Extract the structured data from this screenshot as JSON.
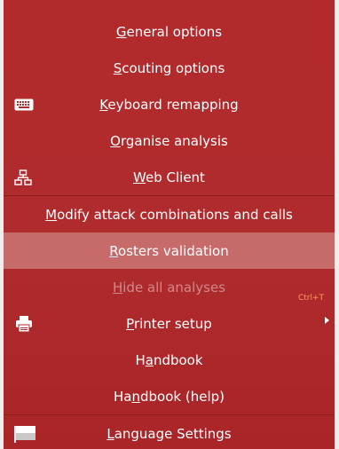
{
  "menu": {
    "items": [
      {
        "key": "general",
        "label_before": "",
        "label_u": "G",
        "label_after": "eneral options"
      },
      {
        "key": "scouting",
        "label_before": "",
        "label_u": "S",
        "label_after": "couting options"
      },
      {
        "key": "keyboard",
        "label_before": "",
        "label_u": "K",
        "label_after": "eyboard remapping",
        "icon": "keyboard-icon"
      },
      {
        "key": "organise",
        "label_before": "",
        "label_u": "O",
        "label_after": "rganise analysis"
      },
      {
        "key": "webclient",
        "label_before": "",
        "label_u": "W",
        "label_after": "eb Client",
        "icon": "network-icon"
      },
      {
        "key": "modify",
        "label_before": "",
        "label_u": "M",
        "label_after": "odify attack combinations and calls"
      },
      {
        "key": "rosters",
        "label_before": "",
        "label_u": "R",
        "label_after": "osters validation",
        "state": "selected"
      },
      {
        "key": "hide",
        "label_before": "",
        "label_u": "H",
        "label_after": "ide all analyses",
        "state": "disabled",
        "shortcut": "Ctrl+T"
      },
      {
        "key": "printer",
        "label_before": "",
        "label_u": "P",
        "label_after": "rinter setup",
        "icon": "printer-icon",
        "has_submenu": true
      },
      {
        "key": "handbook",
        "label_before": "H",
        "label_u": "a",
        "label_after": "ndbook"
      },
      {
        "key": "handbook_help",
        "label_before": "Ha",
        "label_u": "n",
        "label_after": "dbook (help)"
      },
      {
        "key": "language",
        "label_before": "",
        "label_u": "L",
        "label_after": "anguage Settings",
        "icon": "flag-icon"
      }
    ]
  },
  "colors": {
    "menu_background": "#b02b2d",
    "selected_background": "#c66a6a",
    "disabled_text": "#d08888",
    "shortcut_text": "#ff9a5c",
    "text": "#ffffff"
  }
}
